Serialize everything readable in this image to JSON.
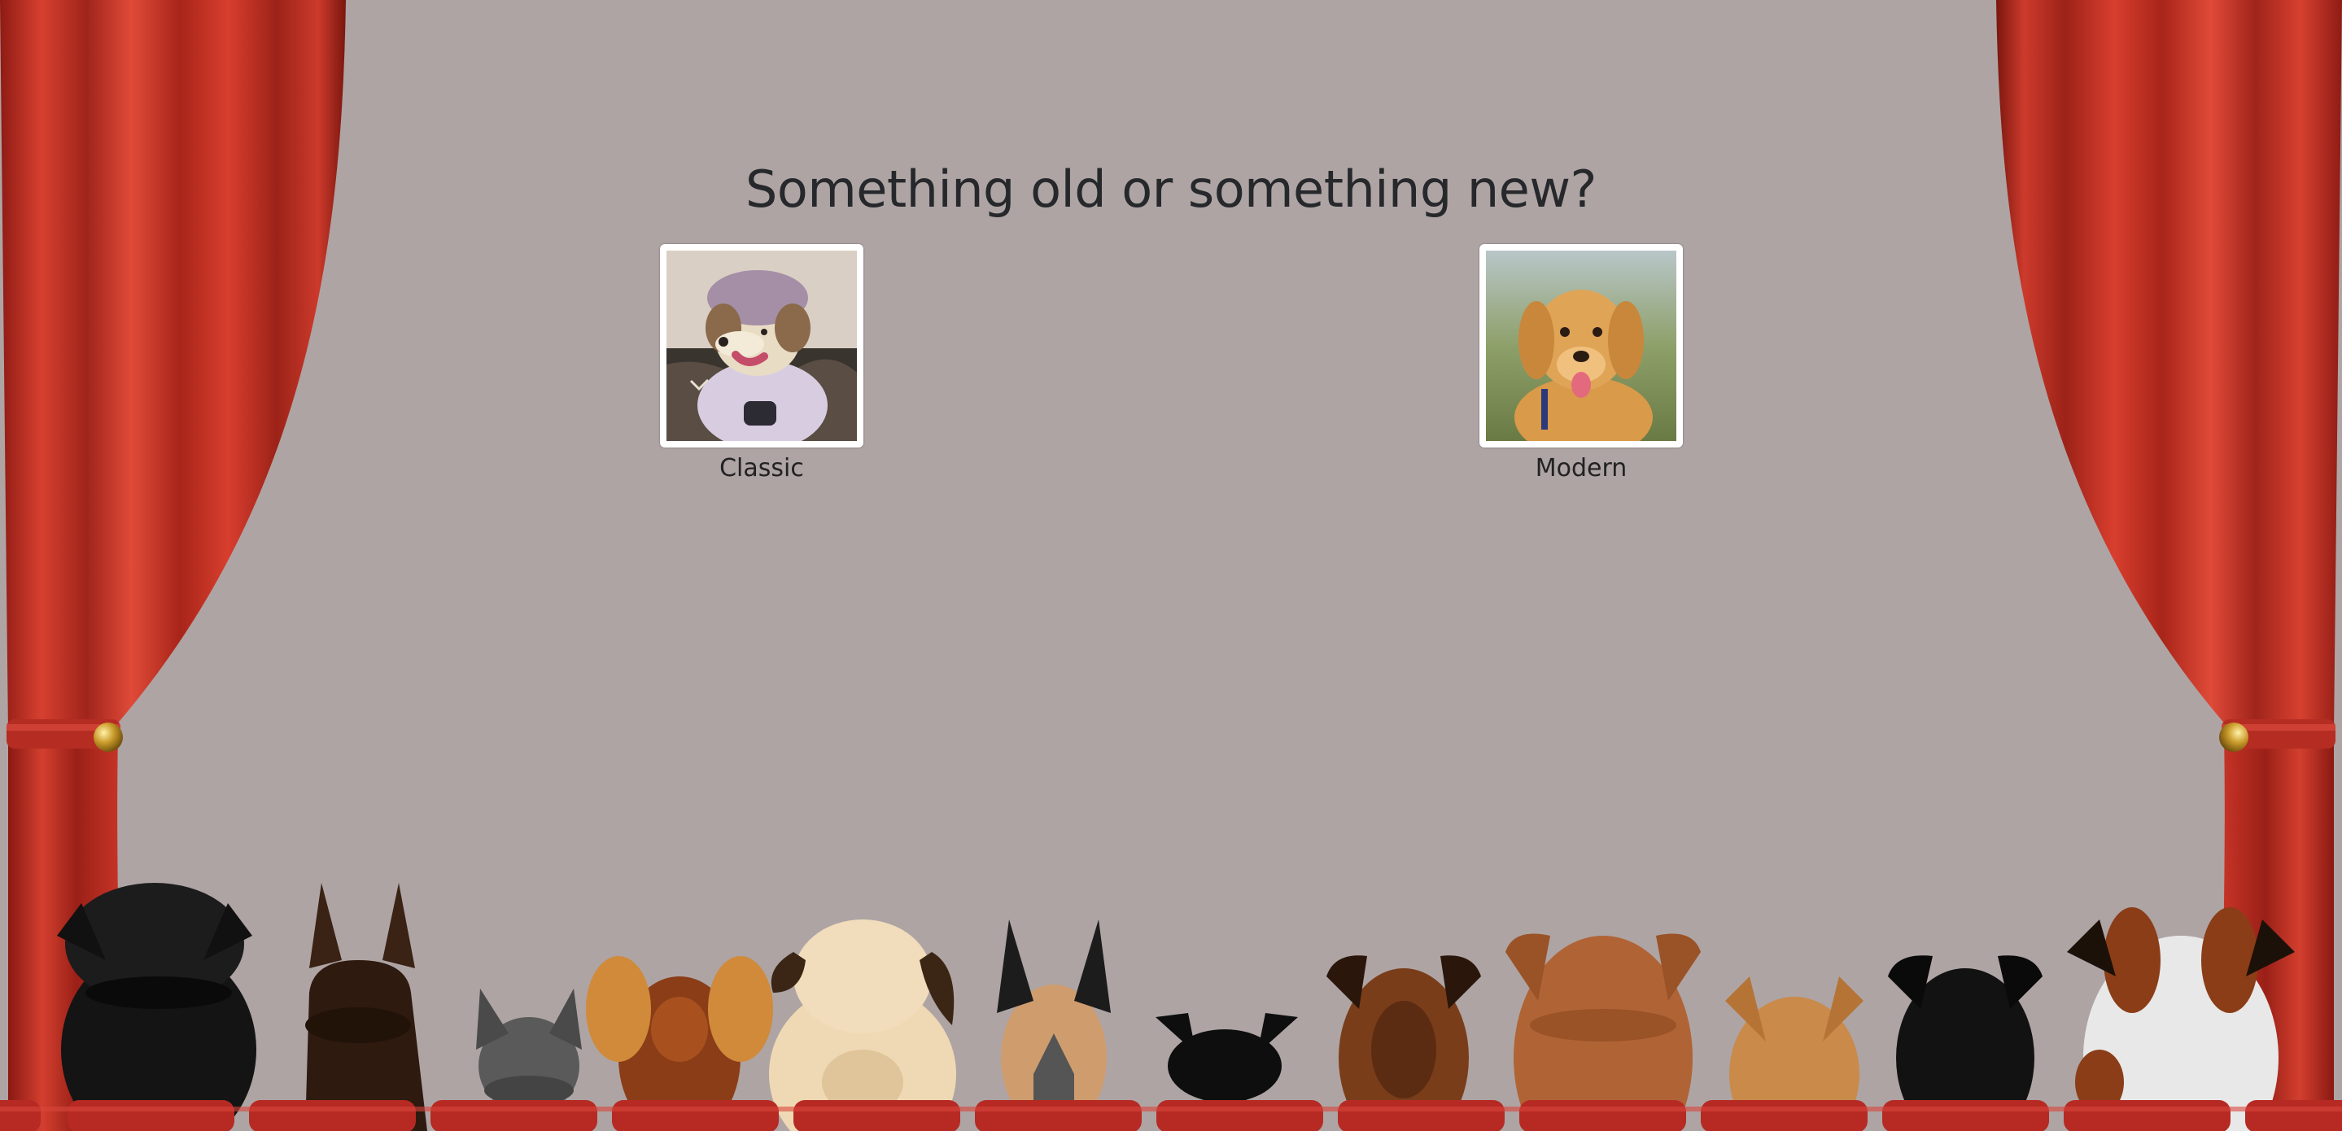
{
  "question": "Something old or something new?",
  "choices": [
    {
      "label": "Classic",
      "image": "dog-in-wig-and-pajamas"
    },
    {
      "label": "Modern",
      "image": "golden-retriever-puppy"
    }
  ],
  "colors": {
    "backdrop": "#aea4a4",
    "curtain": "#c9332a",
    "seat": "#c02a24",
    "text": "#26282b"
  }
}
